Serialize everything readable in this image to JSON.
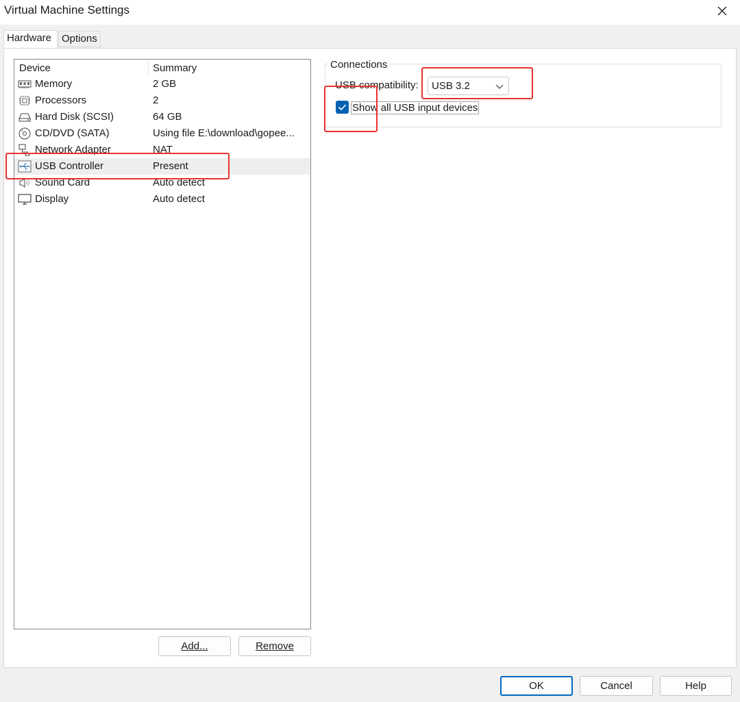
{
  "window": {
    "title": "Virtual Machine Settings"
  },
  "tabs": [
    {
      "label": "Hardware",
      "active": true
    },
    {
      "label": "Options",
      "active": false
    }
  ],
  "device_list": {
    "headers": {
      "device": "Device",
      "summary": "Summary"
    },
    "rows": [
      {
        "device": "Memory",
        "summary": "2 GB",
        "icon": "memory-icon"
      },
      {
        "device": "Processors",
        "summary": "2",
        "icon": "processor-icon"
      },
      {
        "device": "Hard Disk (SCSI)",
        "summary": "64 GB",
        "icon": "hard-disk-icon"
      },
      {
        "device": "CD/DVD (SATA)",
        "summary": "Using file E:\\download\\gopee...",
        "icon": "cd-dvd-icon"
      },
      {
        "device": "Network Adapter",
        "summary": "NAT",
        "icon": "network-adapter-icon"
      },
      {
        "device": "USB Controller",
        "summary": "Present",
        "icon": "usb-icon",
        "selected": true
      },
      {
        "device": "Sound Card",
        "summary": "Auto detect",
        "icon": "speaker-icon"
      },
      {
        "device": "Display",
        "summary": "Auto detect",
        "icon": "monitor-icon"
      }
    ],
    "buttons": {
      "add": "Add...",
      "remove": "Remove"
    }
  },
  "connections": {
    "group_title": "Connections",
    "usb_compat_label": "USB compatibility:",
    "usb_compat_value": "USB 3.2",
    "show_all_label": "Show all USB input devices",
    "show_all_checked": true
  },
  "footer": {
    "ok": "OK",
    "cancel": "Cancel",
    "help": "Help"
  },
  "colors": {
    "accent": "#0063b1",
    "annotation": "#e8312f",
    "selected_row": "#eeeeee"
  }
}
